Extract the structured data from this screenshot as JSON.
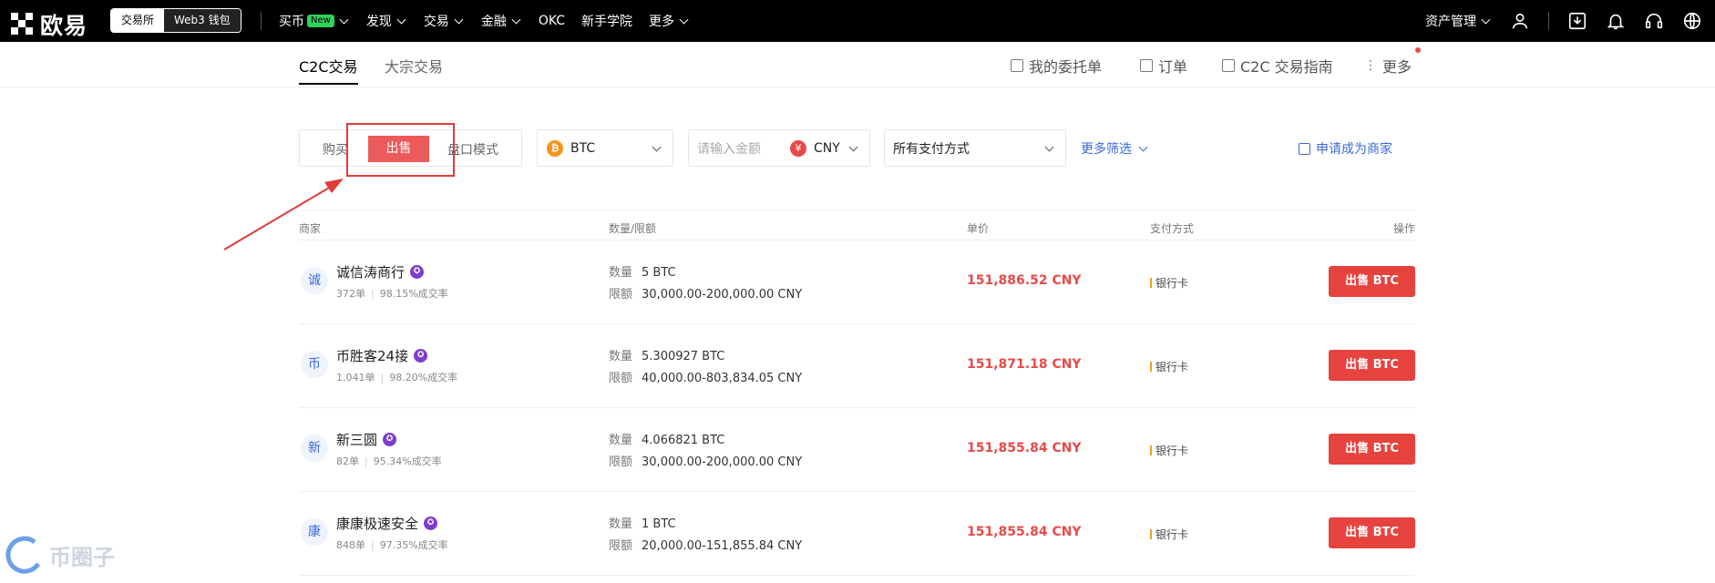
{
  "topnav": {
    "logo_text": "欧易",
    "switcher": {
      "exchange": "交易所",
      "wallet": "Web3 钱包"
    },
    "items": [
      {
        "label": "买币",
        "badge": "New",
        "has_dropdown": true
      },
      {
        "label": "发现",
        "has_dropdown": true
      },
      {
        "label": "交易",
        "has_dropdown": true
      },
      {
        "label": "金融",
        "has_dropdown": true
      },
      {
        "label": "OKC",
        "has_dropdown": false
      },
      {
        "label": "新手学院",
        "has_dropdown": false
      },
      {
        "label": "更多",
        "has_dropdown": true
      }
    ],
    "assets_label": "资产管理",
    "right_icons": [
      "user-icon",
      "download-icon",
      "bell-icon",
      "headset-icon",
      "globe-icon"
    ]
  },
  "subnav": {
    "tabs": [
      "C2C交易",
      "大宗交易"
    ],
    "links": [
      "我的委托单",
      "订单",
      "C2C 交易指南",
      "更多"
    ]
  },
  "filters": {
    "buy_label": "购买",
    "sell_label": "出售",
    "mode_label": "盘口模式",
    "coin": "BTC",
    "amount_placeholder": "请输入金额",
    "currency": "CNY",
    "currency_symbol": "¥",
    "payment": "所有支付方式",
    "more_filters": "更多筛选",
    "apply_merchant": "申请成为商家"
  },
  "table": {
    "headers": [
      "商家",
      "数量/限额",
      "单价",
      "支付方式",
      "操作"
    ],
    "qty_key": "数量",
    "limit_key": "限额",
    "rows": [
      {
        "avatar": "诚",
        "name": "诚信涛商行",
        "orders": "372单",
        "rate": "98.15%成交率",
        "quantity": "5 BTC",
        "limit": "30,000.00-200,000.00 CNY",
        "price": "151,886.52 CNY",
        "payment": "银行卡",
        "action": "出售 BTC"
      },
      {
        "avatar": "币",
        "name": "币胜客24接",
        "orders": "1,041单",
        "rate": "98.20%成交率",
        "quantity": "5.300927 BTC",
        "limit": "40,000.00-803,834.05 CNY",
        "price": "151,871.18 CNY",
        "payment": "银行卡",
        "action": "出售 BTC"
      },
      {
        "avatar": "新",
        "name": "新三圆",
        "orders": "82单",
        "rate": "95.34%成交率",
        "quantity": "4.066821 BTC",
        "limit": "30,000.00-200,000.00 CNY",
        "price": "151,855.84 CNY",
        "payment": "银行卡",
        "action": "出售 BTC"
      },
      {
        "avatar": "康",
        "name": "康康极速安全",
        "orders": "848单",
        "rate": "97.35%成交率",
        "quantity": "1 BTC",
        "limit": "20,000.00-151,855.84 CNY",
        "price": "151,855.84 CNY",
        "payment": "银行卡",
        "action": "出售 BTC"
      }
    ]
  },
  "watermark": "币圈子",
  "colors": {
    "accent_red": "#e6433f",
    "link_blue": "#3a6ad8",
    "nav_bg": "#000000",
    "new_badge": "#2fd25a"
  }
}
